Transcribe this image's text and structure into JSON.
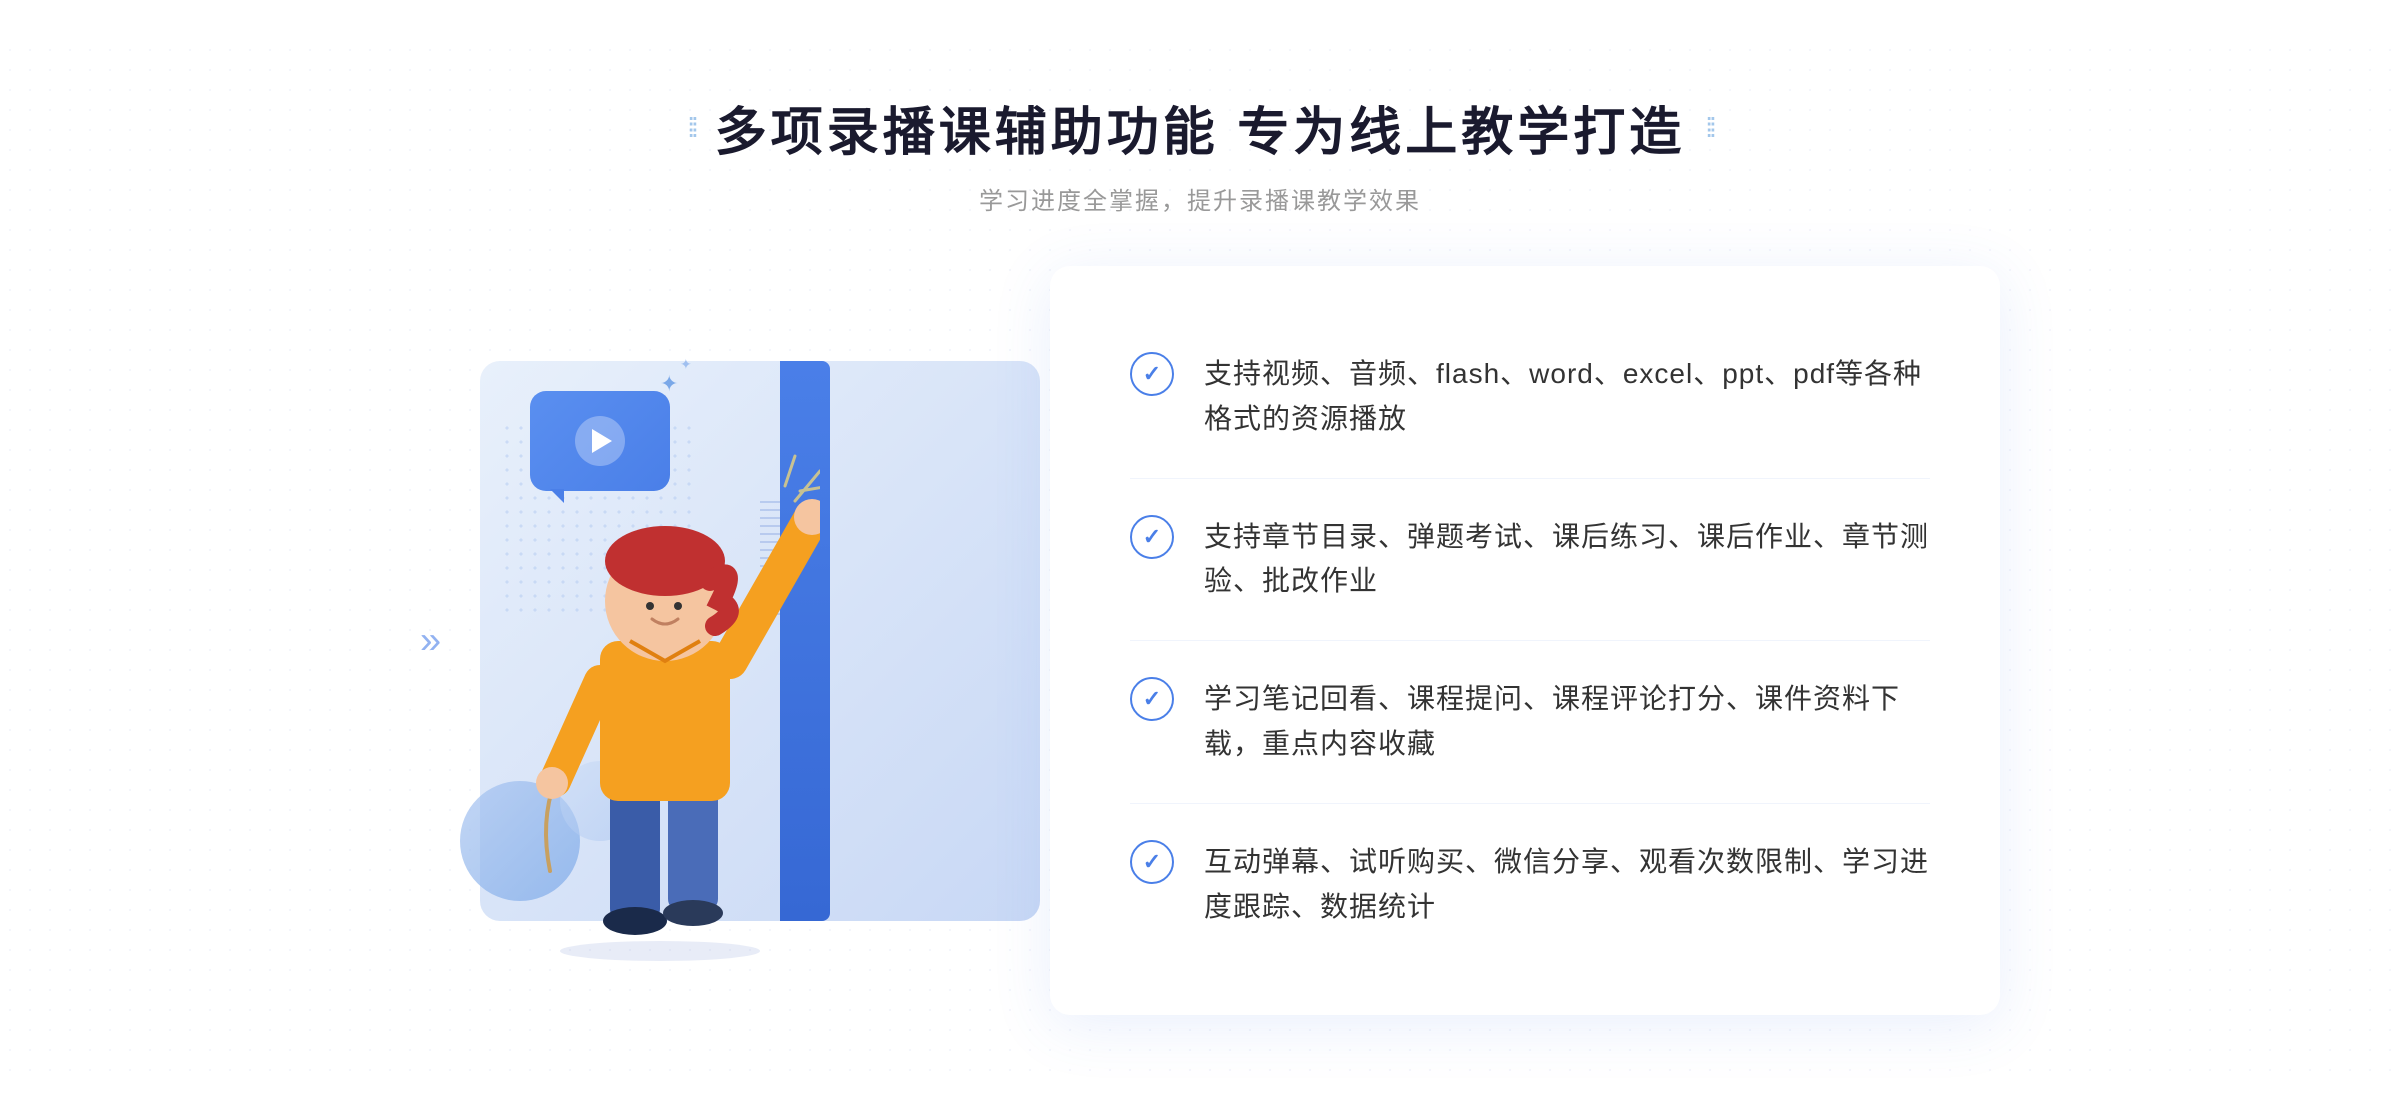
{
  "header": {
    "title": "多项录播课辅助功能 专为线上教学打造",
    "subtitle": "学习进度全掌握，提升录播课教学效果",
    "deco_left": "⁞⁞",
    "deco_right": "⁞⁞"
  },
  "features": [
    {
      "id": 1,
      "text": "支持视频、音频、flash、word、excel、ppt、pdf等各种格式的资源播放"
    },
    {
      "id": 2,
      "text": "支持章节目录、弹题考试、课后练习、课后作业、章节测验、批改作业"
    },
    {
      "id": 3,
      "text": "学习笔记回看、课程提问、课程评论打分、课件资料下载，重点内容收藏"
    },
    {
      "id": 4,
      "text": "互动弹幕、试听购买、微信分享、观看次数限制、学习进度跟踪、数据统计"
    }
  ],
  "colors": {
    "primary_blue": "#4a7fe8",
    "light_blue": "#e8f0fb",
    "text_dark": "#1a1a2e",
    "text_gray": "#999",
    "text_body": "#333"
  }
}
